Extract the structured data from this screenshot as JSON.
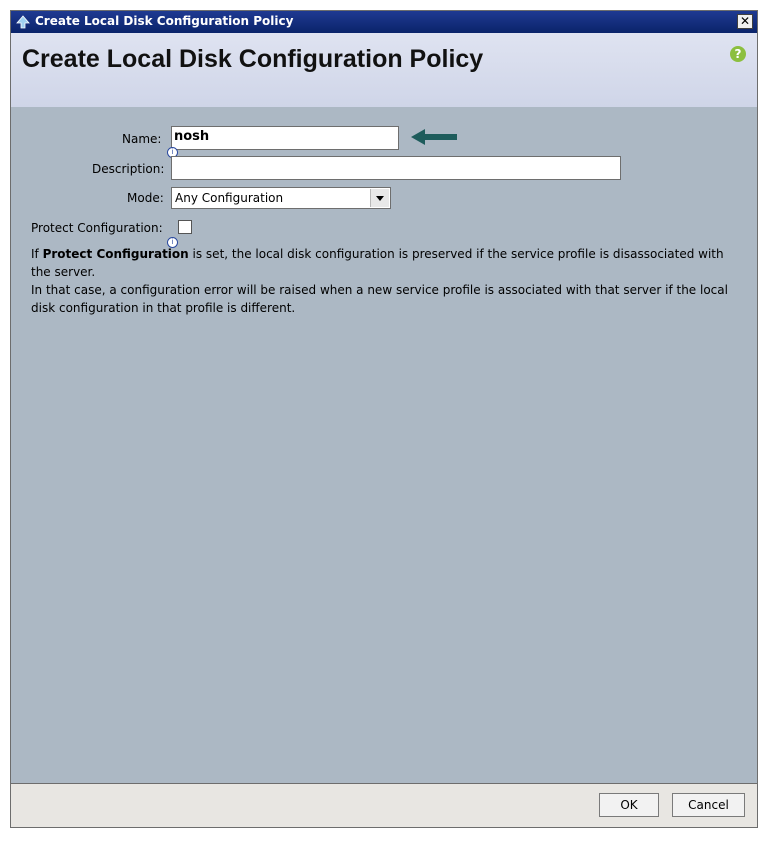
{
  "window": {
    "title": "Create Local Disk Configuration Policy",
    "close_glyph": "✕"
  },
  "header": {
    "heading": "Create Local Disk Configuration Policy",
    "help_glyph": "?"
  },
  "form": {
    "name_label": "Name:",
    "name_value": "nosh",
    "description_label": "Description:",
    "description_value": "",
    "mode_label": "Mode:",
    "mode_value": "Any Configuration",
    "protect_label": "Protect Configuration:",
    "protect_checked": false,
    "info_glyph": "i"
  },
  "help_text": {
    "line1_prefix": "If ",
    "line1_bold": "Protect Configuration",
    "line1_suffix": " is set, the local disk configuration is preserved if the service profile is disassociated with the server.",
    "line2": "In that case, a configuration error will be raised when a new service profile is associated with that server if the local disk configuration in that profile is different."
  },
  "footer": {
    "ok_label": "OK",
    "cancel_label": "Cancel"
  },
  "colors": {
    "content_bg": "#acb8c4",
    "arrow": "#1e5c5c",
    "help": "#8cbf3f"
  }
}
